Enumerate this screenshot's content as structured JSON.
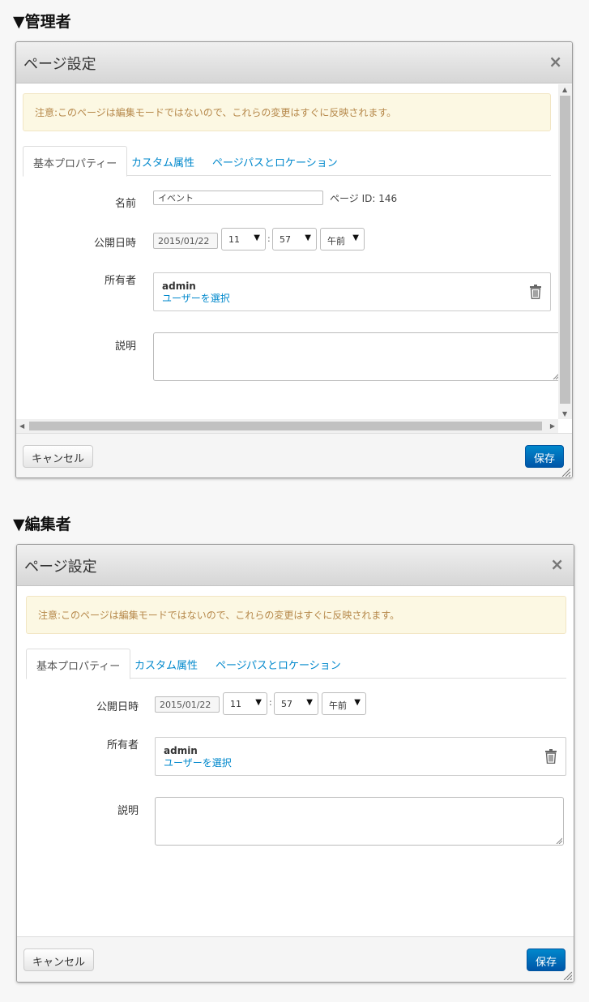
{
  "sections": {
    "admin_heading": "▼管理者",
    "editor_heading": "▼編集者"
  },
  "dialog": {
    "title": "ページ設定",
    "close_glyph": "×",
    "notice": "注意:このページは編集モードではないので、これらの変更はすぐに反映されます。",
    "tabs": [
      "基本プロパティー",
      "カスタム属性",
      "ページパスとロケーション"
    ],
    "name_label": "名前",
    "name_value": "イベント",
    "page_id_text": "ページ ID: 146",
    "publish_label": "公開日時",
    "publish_date": "2015/01/22",
    "hour": "11",
    "minute": "57",
    "ampm": "午前",
    "colon": ":",
    "select_arrow": "▼",
    "owner_label": "所有者",
    "owner_name": "admin",
    "owner_select_link": "ユーザーを選択",
    "description_label": "説明",
    "cancel_label": "キャンセル",
    "save_label": "保存"
  },
  "colors": {
    "link": "#0088cc",
    "primary_button": "#0066bb",
    "alert_bg": "#fcf8e3",
    "alert_text": "#b6884a"
  },
  "icons": [
    "trash-icon",
    "close-icon",
    "resize-grip-icon",
    "chevron-down-icon"
  ]
}
